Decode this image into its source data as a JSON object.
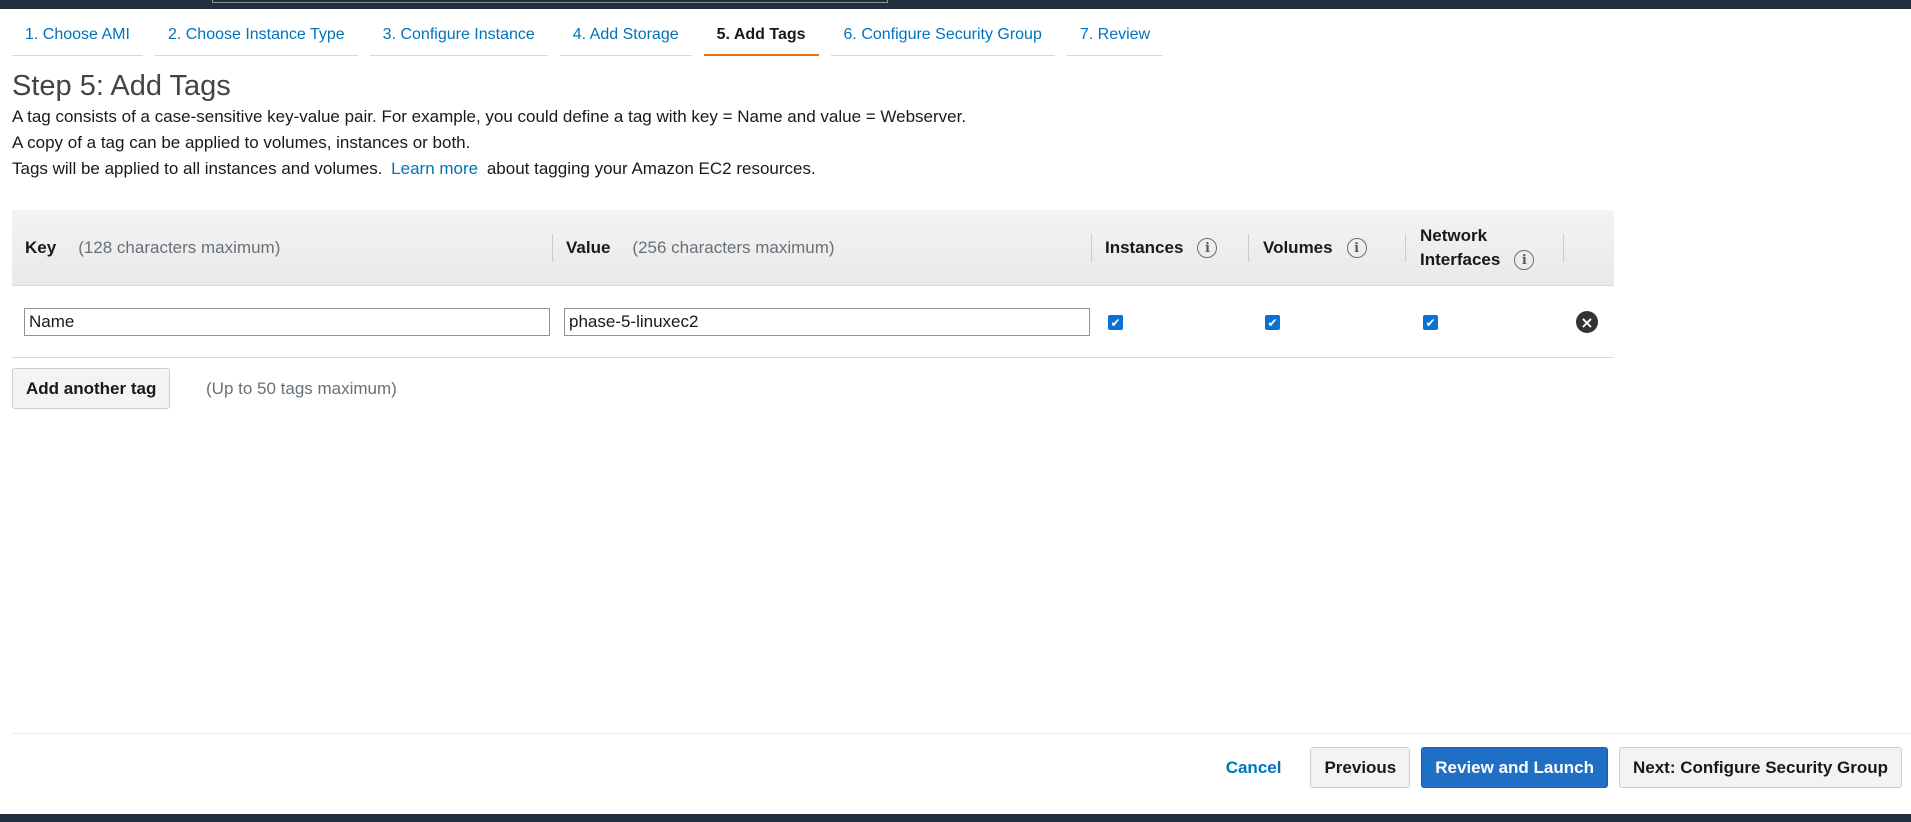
{
  "wizard": {
    "steps": [
      {
        "label": "1. Choose AMI"
      },
      {
        "label": "2. Choose Instance Type"
      },
      {
        "label": "3. Configure Instance"
      },
      {
        "label": "4. Add Storage"
      },
      {
        "label": "5. Add Tags",
        "active": true
      },
      {
        "label": "6. Configure Security Group"
      },
      {
        "label": "7. Review"
      }
    ]
  },
  "page": {
    "title": "Step 5: Add Tags",
    "desc1": "A tag consists of a case-sensitive key-value pair. For example, you could define a tag with key = Name and value = Webserver.",
    "desc2": "A copy of a tag can be applied to volumes, instances or both.",
    "desc3_before": "Tags will be applied to all instances and volumes.",
    "learn_more": "Learn more",
    "desc3_after": "about tagging your Amazon EC2 resources."
  },
  "table": {
    "key_header": "Key",
    "key_hint": "(128 characters maximum)",
    "value_header": "Value",
    "value_hint": "(256 characters maximum)",
    "instances_header": "Instances",
    "volumes_header": "Volumes",
    "network_header_line1": "Network",
    "network_header_line2": "Interfaces",
    "info_glyph": "i",
    "rows": [
      {
        "key": "Name",
        "value": "phase-5-linuxec2",
        "instances": true,
        "volumes": true,
        "network_interfaces": true
      }
    ]
  },
  "add_tag": {
    "button_label": "Add another tag",
    "limit_note": "(Up to 50 tags maximum)"
  },
  "footer": {
    "cancel": "Cancel",
    "previous": "Previous",
    "review_launch": "Review and Launch",
    "next": "Next: Configure Security Group"
  },
  "colors": {
    "link": "#0073bb",
    "active_tab_underline": "#ec7211",
    "primary_button": "#1f6fc5",
    "header_bar": "#232f3e"
  }
}
